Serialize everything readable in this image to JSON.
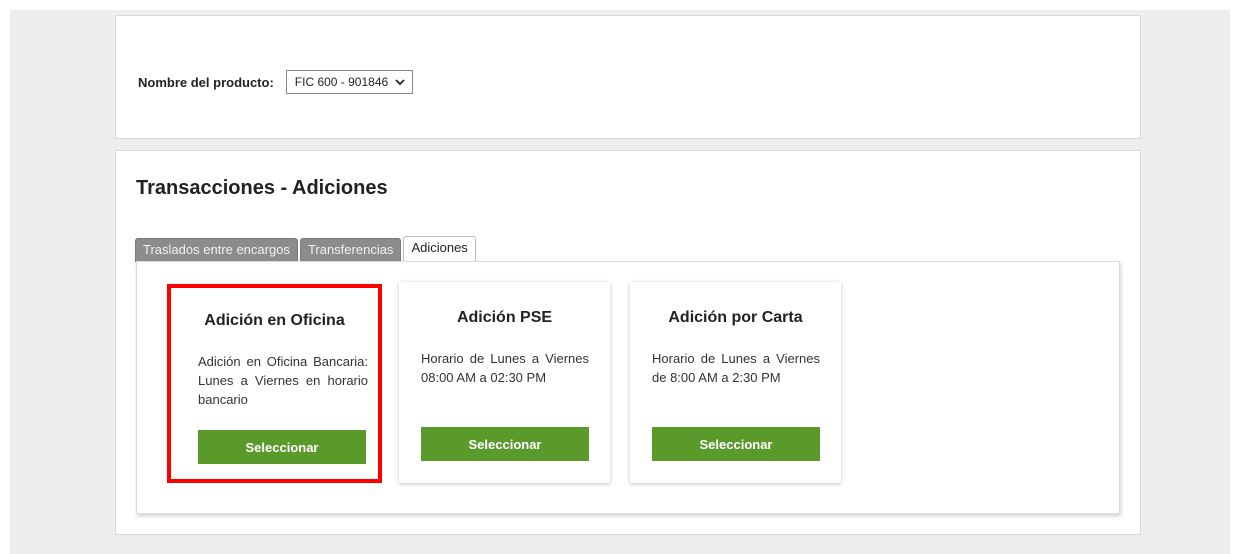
{
  "product": {
    "label": "Nombre del producto:",
    "selected": "FIC 600 - 901846"
  },
  "transactions": {
    "title": "Transacciones - Adiciones",
    "tabs": [
      {
        "label": "Traslados entre encargos",
        "active": false
      },
      {
        "label": "Transferencias",
        "active": false
      },
      {
        "label": "Adiciones",
        "active": true
      }
    ],
    "cards": [
      {
        "title": "Adición en Oficina",
        "description": "Adición en Oficina Bancaria: Lunes a Viernes en horario bancario",
        "button": "Seleccionar",
        "highlighted": true
      },
      {
        "title": "Adición PSE",
        "description": "Horario de Lunes a Viernes 08:00 AM a 02:30 PM",
        "button": "Seleccionar",
        "highlighted": false
      },
      {
        "title": "Adición por Carta",
        "description": "Horario de Lunes a Viernes de 8:00 AM a 2:30 PM",
        "button": "Seleccionar",
        "highlighted": false
      }
    ]
  },
  "colors": {
    "button_green": "#5a9a2b",
    "highlight_red": "#ff0000",
    "inactive_tab": "#8c8c8c"
  },
  "icons": {
    "select_chevron": "chevron-down-icon"
  }
}
